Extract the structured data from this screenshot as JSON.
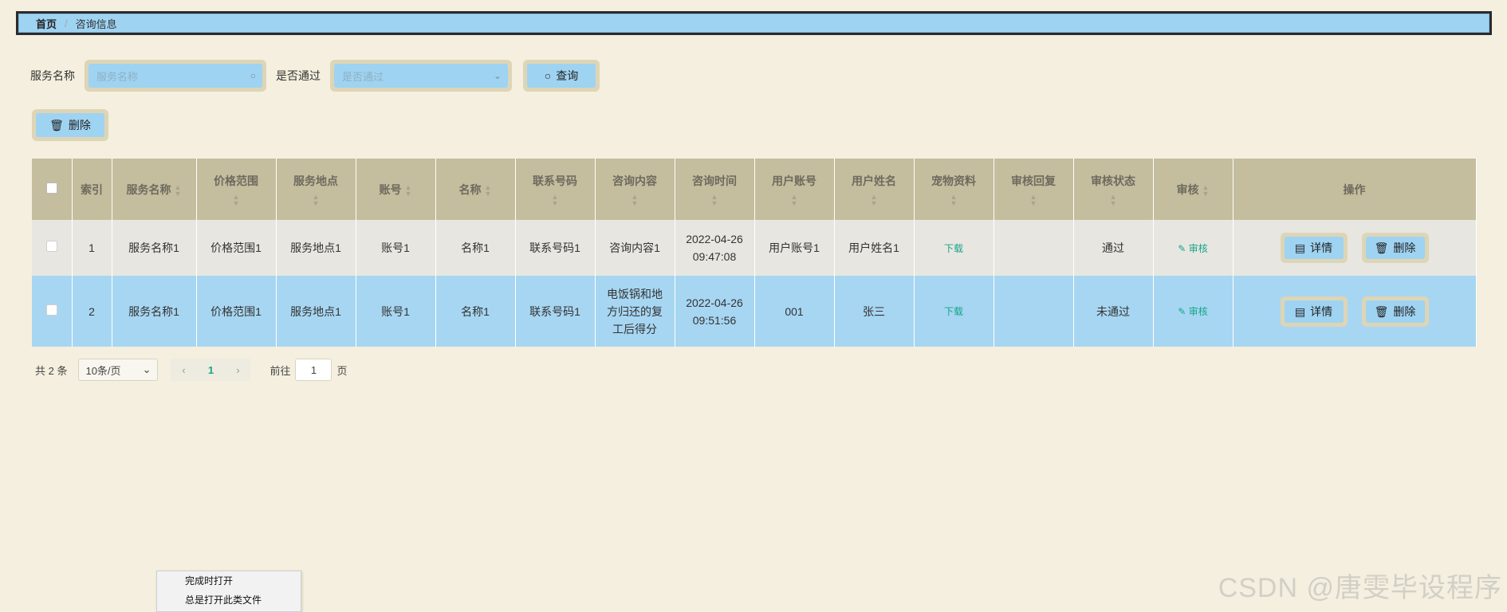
{
  "breadcrumb": {
    "home": "首页",
    "separator": "/",
    "current": "咨询信息"
  },
  "search": {
    "service_label": "服务名称",
    "service_placeholder": "服务名称",
    "passed_label": "是否通过",
    "passed_placeholder": "是否通过",
    "query_button": "查询"
  },
  "toolbar": {
    "delete_button": "删除"
  },
  "table": {
    "columns": [
      "索引",
      "服务名称",
      "价格范围",
      "服务地点",
      "账号",
      "名称",
      "联系号码",
      "咨询内容",
      "咨询时间",
      "用户账号",
      "用户姓名",
      "宠物资料",
      "审核回复",
      "审核状态",
      "审核",
      "操作"
    ],
    "rows": [
      {
        "index": "1",
        "service": "服务名称1",
        "price": "价格范围1",
        "location": "服务地点1",
        "account": "账号1",
        "name": "名称1",
        "phone": "联系号码1",
        "content": "咨询内容1",
        "time_date": "2022-04-26",
        "time_clock": "09:47:08",
        "user_account": "用户账号1",
        "user_name": "用户姓名1",
        "pet_file": "下载",
        "reply": "",
        "status": "通过",
        "audit": "审核",
        "detail_btn": "详情",
        "delete_btn": "删除"
      },
      {
        "index": "2",
        "service": "服务名称1",
        "price": "价格范围1",
        "location": "服务地点1",
        "account": "账号1",
        "name": "名称1",
        "phone": "联系号码1",
        "content": "电饭锅和地方归还的复工后得分",
        "time_date": "2022-04-26",
        "time_clock": "09:51:56",
        "user_account": "001",
        "user_name": "张三",
        "pet_file": "下载",
        "reply": "",
        "status": "未通过",
        "audit": "审核",
        "detail_btn": "详情",
        "delete_btn": "删除"
      }
    ]
  },
  "pagination": {
    "total": "共 2 条",
    "page_size": "10条/页",
    "current_page": "1",
    "goto_label": "前往",
    "goto_value": "1",
    "page_suffix": "页"
  },
  "context_menu": {
    "item1": "完成时打开",
    "item2": "总是打开此类文件"
  },
  "watermark": "CSDN @唐雯毕设程序"
}
